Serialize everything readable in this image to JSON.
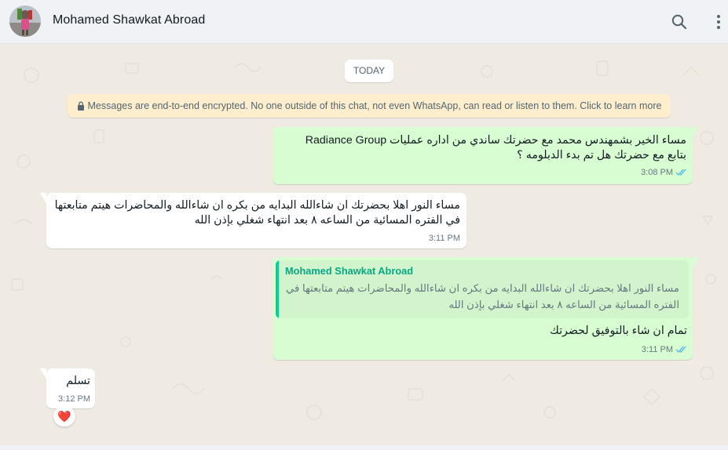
{
  "header": {
    "contact_name": "Mohamed Shawkat Abroad",
    "search_icon": "search-icon",
    "menu_icon": "kebab-menu-icon"
  },
  "chat": {
    "date_divider": "TODAY",
    "encryption_notice": "Messages are end-to-end encrypted. No one outside of this chat, not even WhatsApp, can read or listen to them. Click to learn more",
    "messages": [
      {
        "direction": "outgoing",
        "lines": [
          "مساء الخير بشمهندس محمد مع حضرتك ساندي من اداره عمليات Radiance Group",
          "بتابع مع حضرتك هل تم بدء الدبلومه ؟"
        ],
        "time": "3:08 PM",
        "status": "read"
      },
      {
        "direction": "incoming",
        "lines": [
          "مساء النور اهلا بحضرتك ان شاءالله البدايه من بكره ان شاءالله والمحاضرات هيتم متابعتها",
          "في الفتره المسائية من الساعه ٨ بعد انتهاء شغلي بإذن الله"
        ],
        "time": "3:11 PM"
      },
      {
        "direction": "outgoing",
        "quoted": {
          "author": "Mohamed Shawkat Abroad",
          "lines": [
            "مساء النور اهلا بحضرتك ان شاءالله البدايه من بكره ان شاءالله والمحاضرات هيتم متابعتها في",
            "الفتره المسائية من الساعه ٨ بعد انتهاء شغلي بإذن الله"
          ]
        },
        "lines": [
          "تمام ان شاء بالتوفيق لحضرتك"
        ],
        "time": "3:11 PM",
        "status": "read"
      },
      {
        "direction": "incoming",
        "lines": [
          "تسلم"
        ],
        "time": "3:12 PM",
        "reaction": "❤️"
      }
    ]
  },
  "colors": {
    "outgoing_bubble": "#d9fdd3",
    "incoming_bubble": "#ffffff",
    "chat_background": "#efeae2",
    "read_ticks": "#53bdeb",
    "quote_accent": "#06cf9c"
  }
}
